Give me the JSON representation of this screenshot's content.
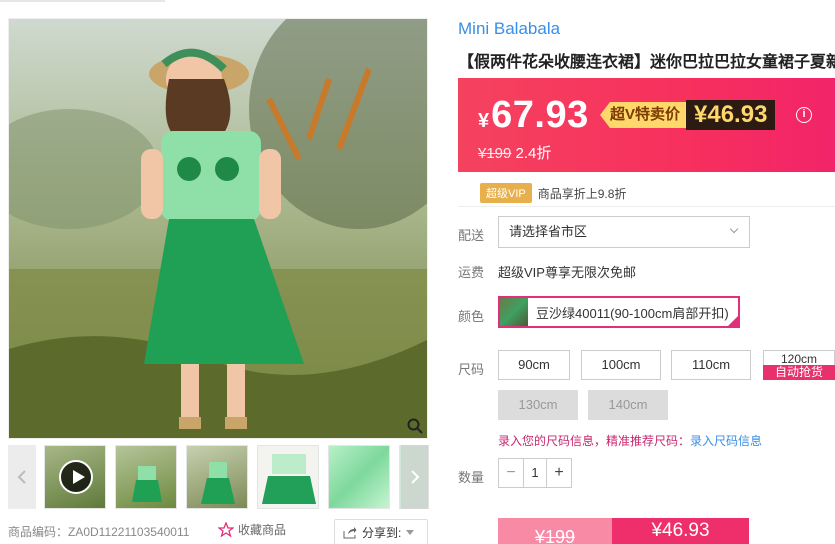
{
  "brand": "Mini Balabala",
  "title": "【假两件花朵收腰连衣裙】迷你巴拉巴拉女童裙子夏新",
  "price": {
    "currency": "¥",
    "current": "67.93",
    "svip_label": "超V特卖价",
    "svip_price": "¥46.93",
    "info_icon": "i",
    "original": "¥199",
    "discount": "2.4折"
  },
  "svip_row": {
    "badge": "超级VIP",
    "text": "商品享折上9.8折"
  },
  "delivery": {
    "label": "配送",
    "select_value": "请选择省市区"
  },
  "shipping": {
    "label": "运费",
    "text": "超级VIP尊享无限次免邮"
  },
  "color": {
    "label": "颜色",
    "selected": "豆沙绿40011(90-100cm肩部开扣)"
  },
  "size": {
    "label": "尺码",
    "options": [
      "90cm",
      "100cm",
      "110cm",
      "120cm",
      "130cm",
      "140cm"
    ],
    "auto_tag": "自动抢货"
  },
  "size_tip": {
    "text": "录入您的尺码信息，精准推荐尺码：",
    "link": "录入尺码信息"
  },
  "quantity": {
    "label": "数量",
    "minus": "−",
    "value": "1",
    "plus": "+"
  },
  "buy": {
    "left_price": "¥199",
    "right_price": "¥46.93"
  },
  "product_code": "商品编码：ZA0D11221103540011",
  "favorite": "收藏商品",
  "share": "分享到:",
  "thumbnails": [
    "video",
    "dress-front",
    "dress-side",
    "dress-flat",
    "fabric",
    "more"
  ],
  "colors": {
    "accent": "#ef2f6b",
    "link": "#3a8ee6",
    "svip_gold": "#ffd76a"
  }
}
